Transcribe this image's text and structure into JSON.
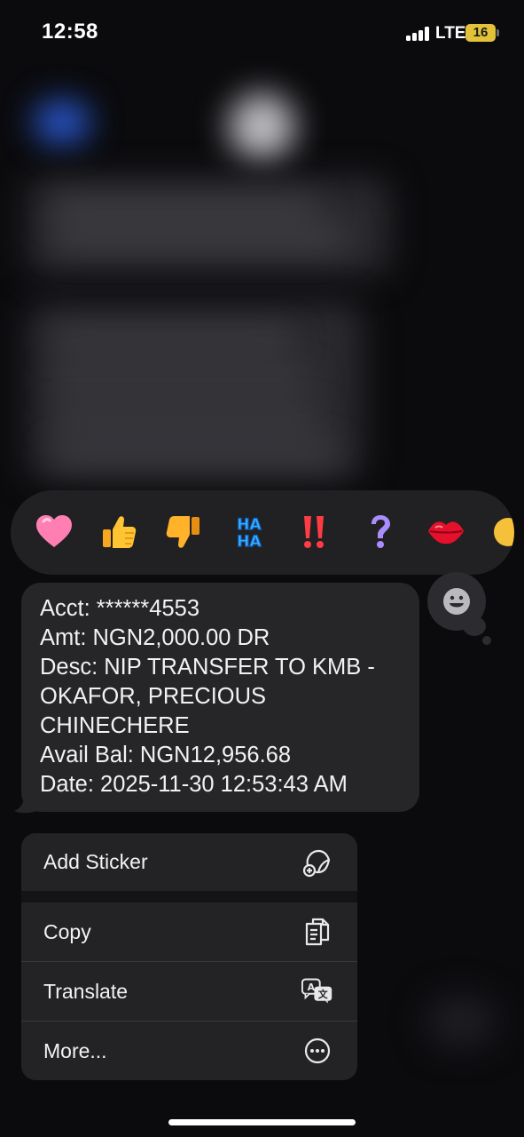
{
  "status_bar": {
    "time": "12:58",
    "network": "LTE",
    "battery": "16"
  },
  "tapbacks": [
    {
      "name": "heart",
      "glyph": "🩷"
    },
    {
      "name": "thumbs-up",
      "glyph": "👍"
    },
    {
      "name": "thumbs-down",
      "glyph": "👎"
    },
    {
      "name": "haha",
      "glyph": "HA HA"
    },
    {
      "name": "exclamation",
      "glyph": "‼"
    },
    {
      "name": "question",
      "glyph": "?"
    },
    {
      "name": "kiss",
      "glyph": "💋"
    }
  ],
  "message": {
    "text": "Acct: ******4553\nAmt: NGN2,000.00 DR\nDesc: NIP TRANSFER TO KMB -\nOKAFOR, PRECIOUS\nCHINECHERE\nAvail Bal: NGN12,956.68\nDate: 2025-11-30 12:53:43 AM"
  },
  "context_menu": {
    "add_sticker": "Add Sticker",
    "copy": "Copy",
    "translate": "Translate",
    "more": "More..."
  },
  "icons": {
    "add_sticker": "sticker-plus-icon",
    "copy": "copy-icon",
    "translate": "translate-icon",
    "more": "ellipsis-circle-icon",
    "sticker": "smiley-sticker-icon"
  },
  "colors": {
    "background": "#0b0b0e",
    "bubble": "#262629",
    "menu": "#232326",
    "battery": "#e2c239"
  }
}
